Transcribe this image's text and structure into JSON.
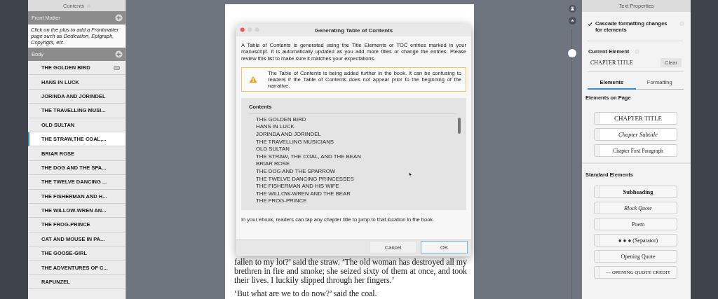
{
  "contents_panel": {
    "title": "Contents",
    "front_matter": {
      "title": "Front Matter",
      "hint": "Click on the plus to add a Frontmatter page such as Dedication, Epigraph, Copyright, etc."
    },
    "body": {
      "title": "Body",
      "items": [
        {
          "label": "THE GOLDEN BIRD",
          "selected": false,
          "marked": true
        },
        {
          "label": "HANS IN LUCK",
          "selected": false,
          "marked": false
        },
        {
          "label": "JORINDA AND JORINDEL",
          "selected": false,
          "marked": false
        },
        {
          "label": "THE TRAVELLING MUSI...",
          "selected": false,
          "marked": false
        },
        {
          "label": "OLD SULTAN",
          "selected": false,
          "marked": false
        },
        {
          "label": "THE STRAW,THE COAL,...",
          "selected": true,
          "marked": false
        },
        {
          "label": "BRIAR ROSE",
          "selected": false,
          "marked": false
        },
        {
          "label": "THE DOG AND THE SPA...",
          "selected": false,
          "marked": false
        },
        {
          "label": "THE TWELVE DANCING ...",
          "selected": false,
          "marked": false
        },
        {
          "label": "THE FISHERMAN AND H...",
          "selected": false,
          "marked": false
        },
        {
          "label": "THE WILLOW-WREN AN...",
          "selected": false,
          "marked": false
        },
        {
          "label": "THE FROG-PRINCE",
          "selected": false,
          "marked": false
        },
        {
          "label": "CAT AND MOUSE IN PA...",
          "selected": false,
          "marked": false
        },
        {
          "label": "THE GOOSE-GIRL",
          "selected": false,
          "marked": false
        },
        {
          "label": "THE ADVENTURES OF C...",
          "selected": false,
          "marked": false
        },
        {
          "label": "RAPUNZEL",
          "selected": false,
          "marked": false
        }
      ]
    }
  },
  "page": {
    "paragraphs": [
      "fallen to my lot?’ said the straw. ‘The old woman has destroyed all my brethren in fire and smoke; she seized sixty of them at once, and took their lives. I luckily slipped through her fingers.’",
      "‘But what are we to do now?’ said the coal."
    ]
  },
  "dialog": {
    "title": "Generating Table of Contents",
    "intro": "A Table of Contents is generated using the Title Elements or TOC entries marked in your manuscript. It is automatically updated as you add more titles or change the entries. Please review this list to make sure it matches your expectations.",
    "warning": "The Table of Contents is being added further in the book. It can be confusing to readers if the Table of Contents does not appear prior to the beginning of the narrative.",
    "list": {
      "header": "Contents",
      "items": [
        "THE GOLDEN BIRD",
        "HANS IN LUCK",
        "JORINDA AND JORINDEL",
        "THE TRAVELLING MUSICIANS",
        "OLD SULTAN",
        "THE STRAW, THE COAL, AND THE BEAN",
        "BRIAR ROSE",
        "THE DOG AND THE SPARROW",
        "THE TWELVE DANCING PRINCESSES",
        "THE FISHERMAN AND HIS WIFE",
        "THE WILLOW-WREN AND THE BEAR",
        "THE FROG-PRINCE"
      ]
    },
    "footnote": "In your ebook, readers can tap any chapter title to jump to that location in the book.",
    "buttons": [
      {
        "label": "Cancel",
        "default": false
      },
      {
        "label": "OK",
        "default": true
      }
    ]
  },
  "text_properties": {
    "title": "Text Properties",
    "cascade": {
      "label": "Cascade formatting changes for elements",
      "checked": true
    },
    "current_element": {
      "label": "Current Element",
      "value": "CHAPTER TITLE",
      "clear": "Clear"
    },
    "tabs": [
      {
        "label": "Elements",
        "selected": true
      },
      {
        "label": "Formatting",
        "selected": false
      }
    ],
    "elements_on_page": {
      "title": "Elements on Page",
      "items": [
        {
          "label": "CHAPTER TITLE",
          "kind": "title"
        },
        {
          "label": "Chapter Subtitle",
          "kind": "subtitle"
        },
        {
          "label": "Chapter First Paragraph",
          "kind": "first-paragraph"
        }
      ]
    },
    "standard_elements": {
      "title": "Standard Elements",
      "items": [
        {
          "label": "Subheading",
          "kind": "subheading"
        },
        {
          "label": "Block Quote",
          "kind": "block-quote"
        },
        {
          "label": "Poem",
          "kind": "poem"
        },
        {
          "label": "● ● ●  (Separator)",
          "kind": "separator"
        },
        {
          "label": "Opening Quote",
          "kind": "opening-quote"
        },
        {
          "label": "— OPENING QUOTE CREDIT",
          "kind": "quote-credit"
        }
      ]
    }
  }
}
